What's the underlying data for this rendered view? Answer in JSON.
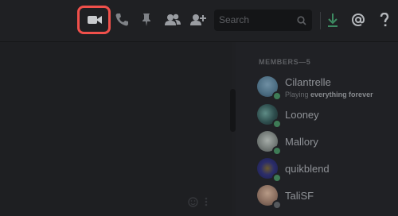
{
  "header": {
    "search_placeholder": "Search",
    "icons": [
      "video-call-icon",
      "voice-call-icon",
      "pin-icon",
      "members-icon",
      "add-friend-icon",
      "search-icon",
      "download-icon",
      "mention-icon",
      "help-icon"
    ],
    "highlight_color": "#f0504b"
  },
  "members": {
    "heading": "MEMBERS—5",
    "list": [
      {
        "name": "Cilantrelle",
        "activity_prefix": "Playing",
        "activity_game": "everything forever",
        "status": "online"
      },
      {
        "name": "Looney",
        "status": "online"
      },
      {
        "name": "Mallory",
        "status": "online"
      },
      {
        "name": "quikblend",
        "status": "online"
      },
      {
        "name": "TaliSF",
        "status": "offline"
      }
    ]
  },
  "colors": {
    "background": "#1f2023",
    "status_online": "#3e7b56",
    "status_offline": "#55585c"
  }
}
